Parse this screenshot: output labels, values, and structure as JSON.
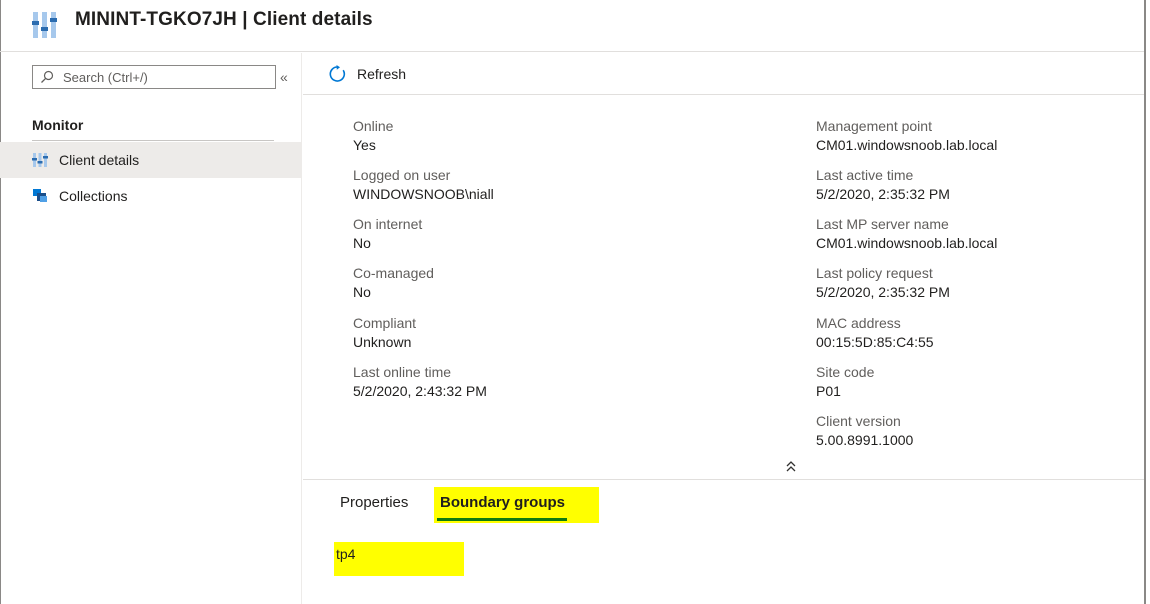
{
  "header": {
    "title": "MININT-TGKO7JH | Client details",
    "icon": "client-details-icon"
  },
  "sidebar": {
    "search": {
      "placeholder": "Search (Ctrl+/)",
      "value": ""
    },
    "collapse_label": "«",
    "section_label": "Monitor",
    "items": [
      {
        "label": "Client details",
        "icon": "client-details-icon",
        "active": true
      },
      {
        "label": "Collections",
        "icon": "collections-icon",
        "active": false
      }
    ]
  },
  "toolbar": {
    "refresh_label": "Refresh"
  },
  "details": {
    "left": [
      {
        "label": "Online",
        "value": "Yes"
      },
      {
        "label": "Logged on user",
        "value": "WINDOWSNOOB\\niall"
      },
      {
        "label": "On internet",
        "value": "No"
      },
      {
        "label": "Co-managed",
        "value": "No"
      },
      {
        "label": "Compliant",
        "value": "Unknown"
      },
      {
        "label": "Last online time",
        "value": "5/2/2020, 2:43:32 PM"
      }
    ],
    "right": [
      {
        "label": "Management point",
        "value": "CM01.windowsnoob.lab.local"
      },
      {
        "label": "Last active time",
        "value": "5/2/2020, 2:35:32 PM"
      },
      {
        "label": "Last MP server name",
        "value": "CM01.windowsnoob.lab.local"
      },
      {
        "label": "Last policy request",
        "value": "5/2/2020, 2:35:32 PM"
      },
      {
        "label": "MAC address",
        "value": "00:15:5D:85:C4:55"
      },
      {
        "label": "Site code",
        "value": "P01"
      },
      {
        "label": "Client version",
        "value": "5.00.8991.1000"
      }
    ],
    "collapse_label": "»"
  },
  "tabs": [
    {
      "label": "Properties",
      "active": false
    },
    {
      "label": "Boundary groups",
      "active": true
    }
  ],
  "boundary_groups": [
    "tp4"
  ],
  "colors": {
    "highlight": "#ffff00",
    "active_tab": "#107c10",
    "accent": "#0078d4"
  }
}
